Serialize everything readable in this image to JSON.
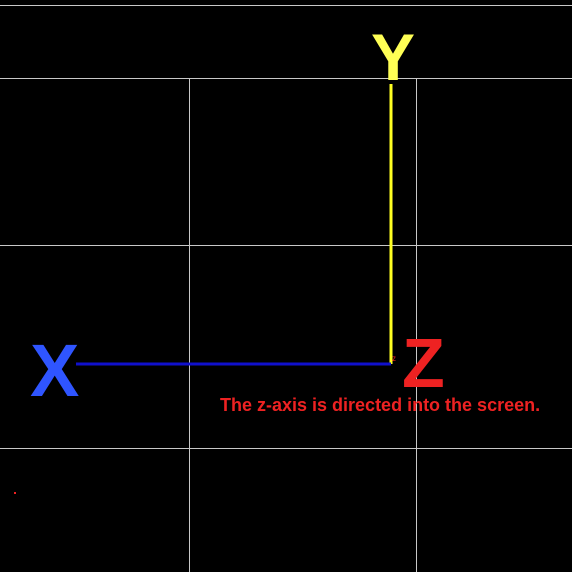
{
  "axes": {
    "x": {
      "label": "X",
      "color": "#2f55ff",
      "line_color": "#1010cc"
    },
    "y": {
      "label": "Y",
      "color": "#ffff55",
      "line_color": "#ffff22"
    },
    "z": {
      "label": "Z",
      "color": "#ee2222",
      "origin_mark": "z"
    }
  },
  "note": {
    "text": "The z-axis is directed into the screen.",
    "color": "#ee2222"
  },
  "grid": {
    "color": "#c8c8c8"
  },
  "background": "#000000"
}
